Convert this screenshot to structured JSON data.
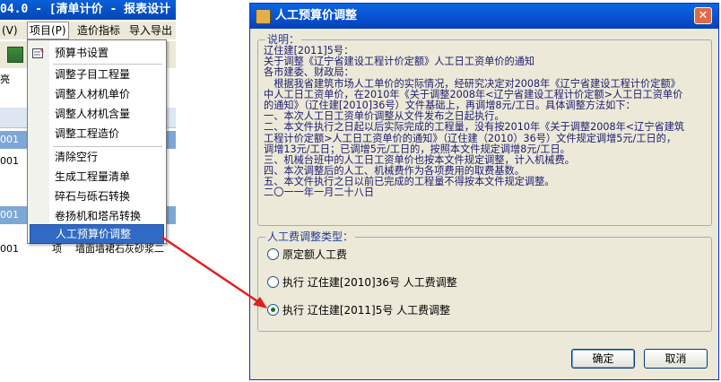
{
  "background_app": {
    "title": "04.0 - [清单计价 - 报表设计",
    "menubar": {
      "view": "(V)",
      "project": "项目(P)",
      "price_index": "造价指标",
      "import_export": "导入导出"
    },
    "toolbar_dropdown": "亮",
    "grid_rows": [
      {
        "code": "001",
        "unit": "",
        "desc": ""
      },
      {
        "code": "001",
        "unit": "",
        "desc": ""
      },
      {
        "code": "001",
        "unit": "",
        "desc": ""
      },
      {
        "code": "001",
        "unit": "项",
        "desc": "墙面墙裙石灰砂浆二"
      }
    ]
  },
  "context_menu": {
    "items": [
      {
        "label": "预算书设置"
      },
      {
        "label": "调整子目工程量"
      },
      {
        "label": "调整人材机单价"
      },
      {
        "label": "调整人材机含量"
      },
      {
        "label": "调整工程造价"
      },
      {
        "label": "清除空行"
      },
      {
        "label": "生成工程量清单"
      },
      {
        "label": "碎石与砾石转换"
      },
      {
        "label": "卷扬机和塔吊转换"
      },
      {
        "label": "人工预算价调整"
      }
    ]
  },
  "dialog": {
    "title": "人工预算价调整",
    "close_symbol": "✕",
    "notice_legend": "说明：",
    "notice_lines": [
      "辽住建[2011]5号：",
      "关于调整《辽宁省建设工程计价定额》人工日工资单价的通知",
      "各市建委、财政局：",
      "　根据我省建筑市场人工单价的实际情况，经研究决定对2008年《辽宁省建设工程计价定额》",
      "中人工日工资单价，在2010年《关于调整2008年<辽宁省建设工程计价定额>人工日工资单价",
      "的通知》（辽住建[2010]36号）文件基础上，再调增8元/工日。具体调整方法如下：",
      "一、本次人工日工资单价调整从文件发布之日起执行。",
      "二、本文件执行之日起以后实际完成的工程量，没有按2010年《关于调整2008年<辽宁省建筑",
      "工程计价定额>人工日工资单价的通知》（辽住建（2010）36号）文件规定调增5元/工日的，",
      "调增13元/工日；已调增5元/工日的，按照本文件规定调增8元/工日。",
      "三、机械台班中的人工日工资单价也按本文件规定调整，计入机械费。",
      "四、本次调整后的人工、机械费作为各项费用的取费基数。",
      "五、本文件执行之日以前已完成的工程量不得按本文件规定调整。",
      "二〇一一年一月二十八日"
    ],
    "adjust_legend": "人工费调整类型：",
    "options": [
      {
        "label": "原定额人工费",
        "selected": false
      },
      {
        "label": "执行 辽住建[2010]36号 人工费调整",
        "selected": false
      },
      {
        "label": "执行 辽住建[2011]5号 人工费调整",
        "selected": true
      }
    ],
    "ok_label": "确定",
    "cancel_label": "取消"
  },
  "colors": {
    "titlebar": "#0a55d5",
    "dialog_bg": "#ece9d8",
    "selection": "#316ac5",
    "arrow": "#e02020"
  }
}
